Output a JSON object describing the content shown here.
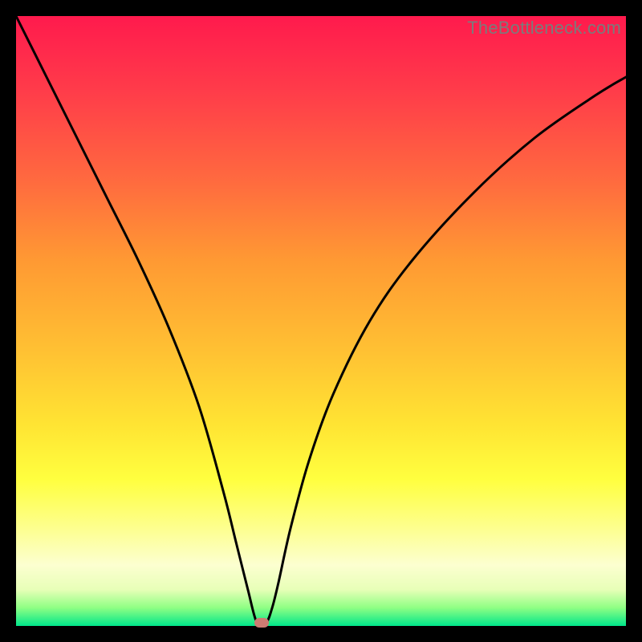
{
  "watermark": "TheBottleneck.com",
  "colors": {
    "background": "#000000",
    "curve_stroke": "#000000",
    "marker_fill": "#cc7b72",
    "gradient_top": "#ff1a4d",
    "gradient_bottom": "#00e68a"
  },
  "chart_data": {
    "type": "line",
    "title": "",
    "xlabel": "",
    "ylabel": "",
    "xlim": [
      0,
      100
    ],
    "ylim": [
      0,
      100
    ],
    "grid": false,
    "legend": false,
    "series": [
      {
        "name": "bottleneck-curve",
        "x": [
          0,
          5,
          10,
          15,
          20,
          25,
          30,
          34,
          36,
          38,
          39.5,
          41,
          42,
          43,
          45,
          48,
          52,
          58,
          65,
          75,
          85,
          95,
          100
        ],
        "y": [
          100,
          90,
          80,
          70,
          60,
          49,
          36,
          22,
          14,
          6,
          0.5,
          0.5,
          3,
          7,
          16,
          27,
          38,
          50,
          60,
          71,
          80,
          87,
          90
        ]
      }
    ],
    "marker": {
      "x": 40.2,
      "y": 0.5
    },
    "notes": "V-shaped bottleneck curve over a red-to-green vertical gradient; axes unlabeled; minimum near x≈40 at y≈0."
  }
}
